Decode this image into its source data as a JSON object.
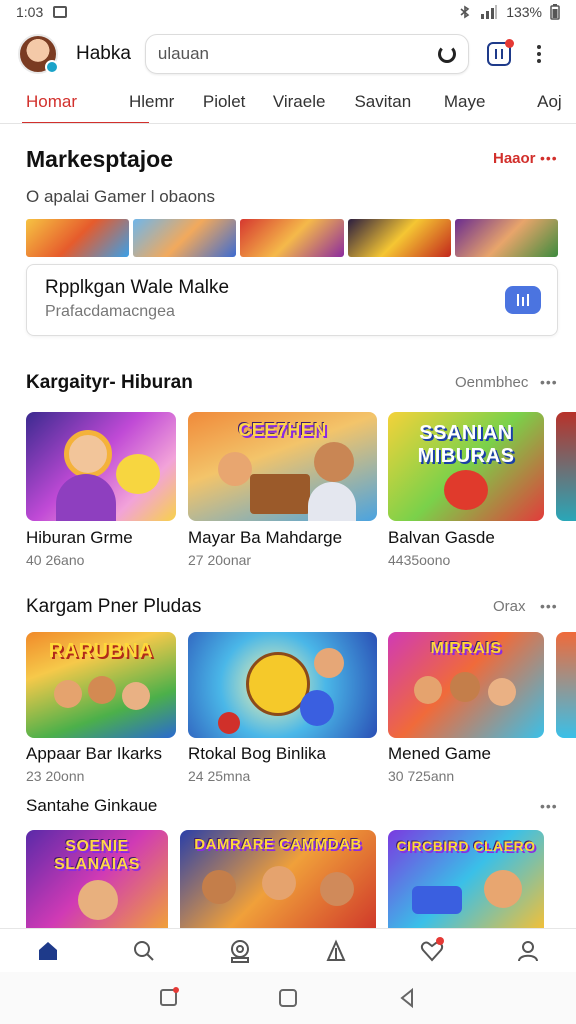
{
  "status_bar": {
    "time": "1:03",
    "battery": "133%"
  },
  "header": {
    "title": "Habka",
    "search": {
      "value": "ulauan",
      "placeholder": ""
    }
  },
  "tabs": [
    {
      "label": "Homar",
      "active": true
    },
    {
      "label": "Hlemr",
      "active": false
    },
    {
      "label": "Piolet",
      "active": false
    },
    {
      "label": "Viraele",
      "active": false
    },
    {
      "label": "Savitan",
      "active": false
    },
    {
      "label": "Maye",
      "active": false
    },
    {
      "label": "Aoj",
      "active": false
    }
  ],
  "marketplace": {
    "title": "Markesptajoe",
    "see_all": "Haaor",
    "subtitle": "O apalai Gamer l obaons",
    "promo": {
      "title": "Rpplkgan Wale Malke",
      "subtitle": "Prafacdamacngea"
    }
  },
  "sections": [
    {
      "title": "Kargaityr- Hiburan",
      "see_all": "Oenmbhec",
      "items": [
        {
          "name": "Hiburan Grme",
          "meta": "40 26ano",
          "art_text": ""
        },
        {
          "name": "Mayar Ba Mahdarge",
          "meta": "27 20onar",
          "art_text": "CEE7HEN"
        },
        {
          "name": "Balvan Gasde",
          "meta": "4435oono",
          "art_text": "SSANIAN MIBURAS"
        }
      ]
    },
    {
      "title": "Kargam Pner Pludas",
      "see_all": "Orax",
      "items": [
        {
          "name": "Appaar Bar Ikarks",
          "meta": "23 20onn",
          "art_text": "RARUBNA"
        },
        {
          "name": "Rtokal Bog Binlika",
          "meta": "24 25mna",
          "art_text": ""
        },
        {
          "name": "Mened Game",
          "meta": "30 725ann",
          "art_text": "MIRRAIS"
        }
      ]
    },
    {
      "title": "Santahe Ginkaue",
      "see_all": "",
      "items": [
        {
          "name": "",
          "meta": "",
          "art_text": "SOENIE SLANAIAS"
        },
        {
          "name": "",
          "meta": "",
          "art_text": "DAMRARE CAMMDAB"
        },
        {
          "name": "",
          "meta": "",
          "art_text": "CIRCBIRD CLAERO"
        }
      ]
    }
  ],
  "colors": {
    "accent": "#d2302c",
    "nav_active": "#1e3a8a",
    "promo_button": "#4b74e0"
  },
  "bottom_nav": [
    "home-icon",
    "search-icon",
    "badge-icon",
    "library-icon",
    "heart-icon",
    "profile-icon"
  ]
}
